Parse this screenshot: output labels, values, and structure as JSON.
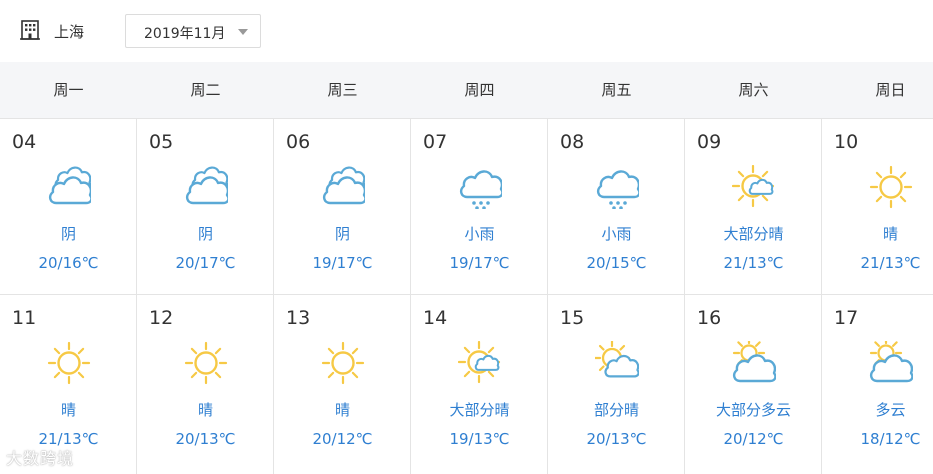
{
  "header": {
    "city": "上海",
    "city_icon": "building-icon",
    "month": "2019年11月"
  },
  "weekdays": [
    "周一",
    "周二",
    "周三",
    "周四",
    "周五",
    "周六",
    "周日"
  ],
  "colors": {
    "text_blue": "#2f7fd1",
    "cloud": "#5aa9d6",
    "sun": "#f6c945",
    "header_bg": "#f5f6f8"
  },
  "weeks": [
    [
      {
        "date": "04",
        "icon": "cloudy-icon",
        "condition": "阴",
        "temp": "20/16℃"
      },
      {
        "date": "05",
        "icon": "cloudy-icon",
        "condition": "阴",
        "temp": "20/17℃"
      },
      {
        "date": "06",
        "icon": "cloudy-icon",
        "condition": "阴",
        "temp": "19/17℃"
      },
      {
        "date": "07",
        "icon": "light-rain-icon",
        "condition": "小雨",
        "temp": "19/17℃"
      },
      {
        "date": "08",
        "icon": "light-rain-icon",
        "condition": "小雨",
        "temp": "20/15℃"
      },
      {
        "date": "09",
        "icon": "mostly-sunny-icon",
        "condition": "大部分晴",
        "temp": "21/13℃"
      },
      {
        "date": "10",
        "icon": "sunny-icon",
        "condition": "晴",
        "temp": "21/13℃"
      }
    ],
    [
      {
        "date": "11",
        "icon": "sunny-icon",
        "condition": "晴",
        "temp": "21/13℃"
      },
      {
        "date": "12",
        "icon": "sunny-icon",
        "condition": "晴",
        "temp": "20/13℃"
      },
      {
        "date": "13",
        "icon": "sunny-icon",
        "condition": "晴",
        "temp": "20/12℃"
      },
      {
        "date": "14",
        "icon": "mostly-sunny-icon",
        "condition": "大部分晴",
        "temp": "19/13℃"
      },
      {
        "date": "15",
        "icon": "partly-sunny-icon",
        "condition": "部分晴",
        "temp": "20/13℃"
      },
      {
        "date": "16",
        "icon": "mostly-cloudy-icon",
        "condition": "大部分多云",
        "temp": "20/12℃"
      },
      {
        "date": "17",
        "icon": "cloudy-sun-icon",
        "condition": "多云",
        "temp": "18/12℃"
      }
    ]
  ],
  "watermark": "大数跨境"
}
